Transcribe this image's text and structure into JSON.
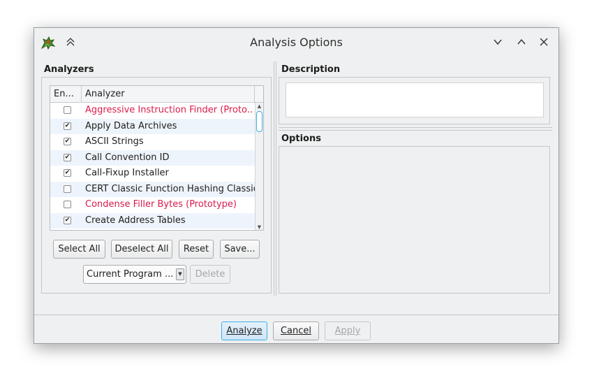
{
  "window": {
    "title": "Analysis Options",
    "icon": "ghidra-dragon-icon"
  },
  "titlebar_buttons": [
    "keep-above-icon",
    "minimize-icon",
    "maximize-icon",
    "close-icon"
  ],
  "analyzers": {
    "heading": "Analyzers",
    "columns": [
      "En...",
      "Analyzer"
    ],
    "rows": [
      {
        "enabled": false,
        "name": "Aggressive Instruction Finder (Proto...",
        "prototype": true
      },
      {
        "enabled": true,
        "name": "Apply Data Archives",
        "prototype": false
      },
      {
        "enabled": true,
        "name": "ASCII Strings",
        "prototype": false
      },
      {
        "enabled": true,
        "name": "Call Convention ID",
        "prototype": false
      },
      {
        "enabled": true,
        "name": "Call-Fixup Installer",
        "prototype": false
      },
      {
        "enabled": false,
        "name": "CERT Classic Function Hashing Classic",
        "prototype": false
      },
      {
        "enabled": false,
        "name": "Condense Filler Bytes (Prototype)",
        "prototype": true
      },
      {
        "enabled": true,
        "name": "Create Address Tables",
        "prototype": false
      }
    ],
    "buttons": {
      "select_all": "Select All",
      "deselect_all": "Deselect All",
      "reset": "Reset",
      "save": "Save..."
    },
    "profile_combo": "Current Program ...",
    "delete": "Delete"
  },
  "description": {
    "heading": "Description",
    "text": ""
  },
  "options": {
    "heading": "Options"
  },
  "footer": {
    "analyze": "Analyze",
    "cancel": "Cancel",
    "apply": "Apply"
  },
  "colors": {
    "prototype_text": "#da1b4b",
    "accent": "#3daee9"
  }
}
